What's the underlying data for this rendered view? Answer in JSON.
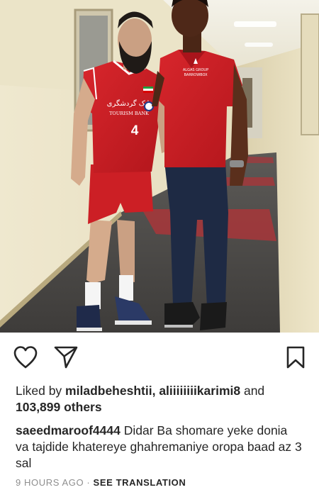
{
  "post": {
    "photo": {
      "jersey_text": "TOURISM BANK",
      "jersey_arabic": "بانک گردشگری",
      "jersey_number": "4",
      "shirt_badge_line1": "ALGAS GROUP",
      "shirt_badge_line2": "BARROWBOX"
    },
    "actions": {
      "like_icon": "heart-outline-icon",
      "share_icon": "paper-plane-icon",
      "save_icon": "bookmark-outline-icon"
    },
    "likes": {
      "prefix": "Liked by ",
      "user1": "miladbeheshtii",
      "separator": ", ",
      "user2": "aliiiiiiiikarimi8",
      "and_text": " and ",
      "others": "103,899 others"
    },
    "caption": {
      "username": "saeedmaroof4444",
      "text": "Didar Ba shomare yeke donia va  tajdide khatereye ghahremaniye oropa baad az 3 sal"
    },
    "meta": {
      "timestamp": "9 HOURS AGO",
      "dot": " · ",
      "see_translation": "SEE TRANSLATION"
    }
  }
}
